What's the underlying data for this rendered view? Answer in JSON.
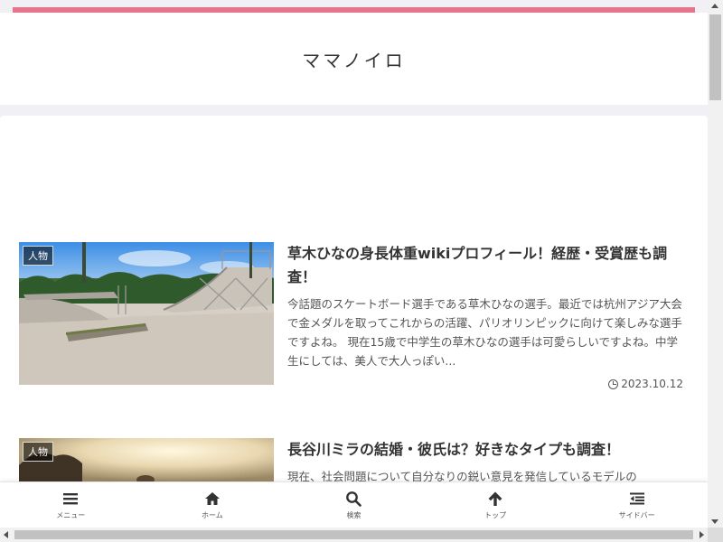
{
  "site": {
    "title": "ママノイロ",
    "accent_color": "#e8738a"
  },
  "posts": [
    {
      "category": "人物",
      "title": "草木ひなの身長体重wikiプロフィール！経歴・受賞歴も調査！",
      "excerpt": "今話題のスケートボード選手である草木ひなの選手。最近では杭州アジア大会で金メダルを取ってこれからの活躍、パリオリンピックに向けて楽しみな選手ですよね。 現在15歳で中学生の草木ひなの選手は可愛らしいですよね。中学生にしては、美人で大人っぽい...",
      "date": "2023.10.12",
      "thumbnail": "skatepark"
    },
    {
      "category": "人物",
      "title": "長谷川ミラの結婚・彼氏は？好きなタイプも調査！",
      "excerpt": "現在、社会問題について自分なりの鋭い意見を発信しているモデルの",
      "thumbnail": "sunset"
    }
  ],
  "bottom_nav": [
    {
      "label": "メニュー",
      "icon": "menu-icon"
    },
    {
      "label": "ホーム",
      "icon": "home-icon"
    },
    {
      "label": "検索",
      "icon": "search-icon"
    },
    {
      "label": "トップ",
      "icon": "arrow-up-icon"
    },
    {
      "label": "サイドバー",
      "icon": "sidebar-icon"
    }
  ]
}
